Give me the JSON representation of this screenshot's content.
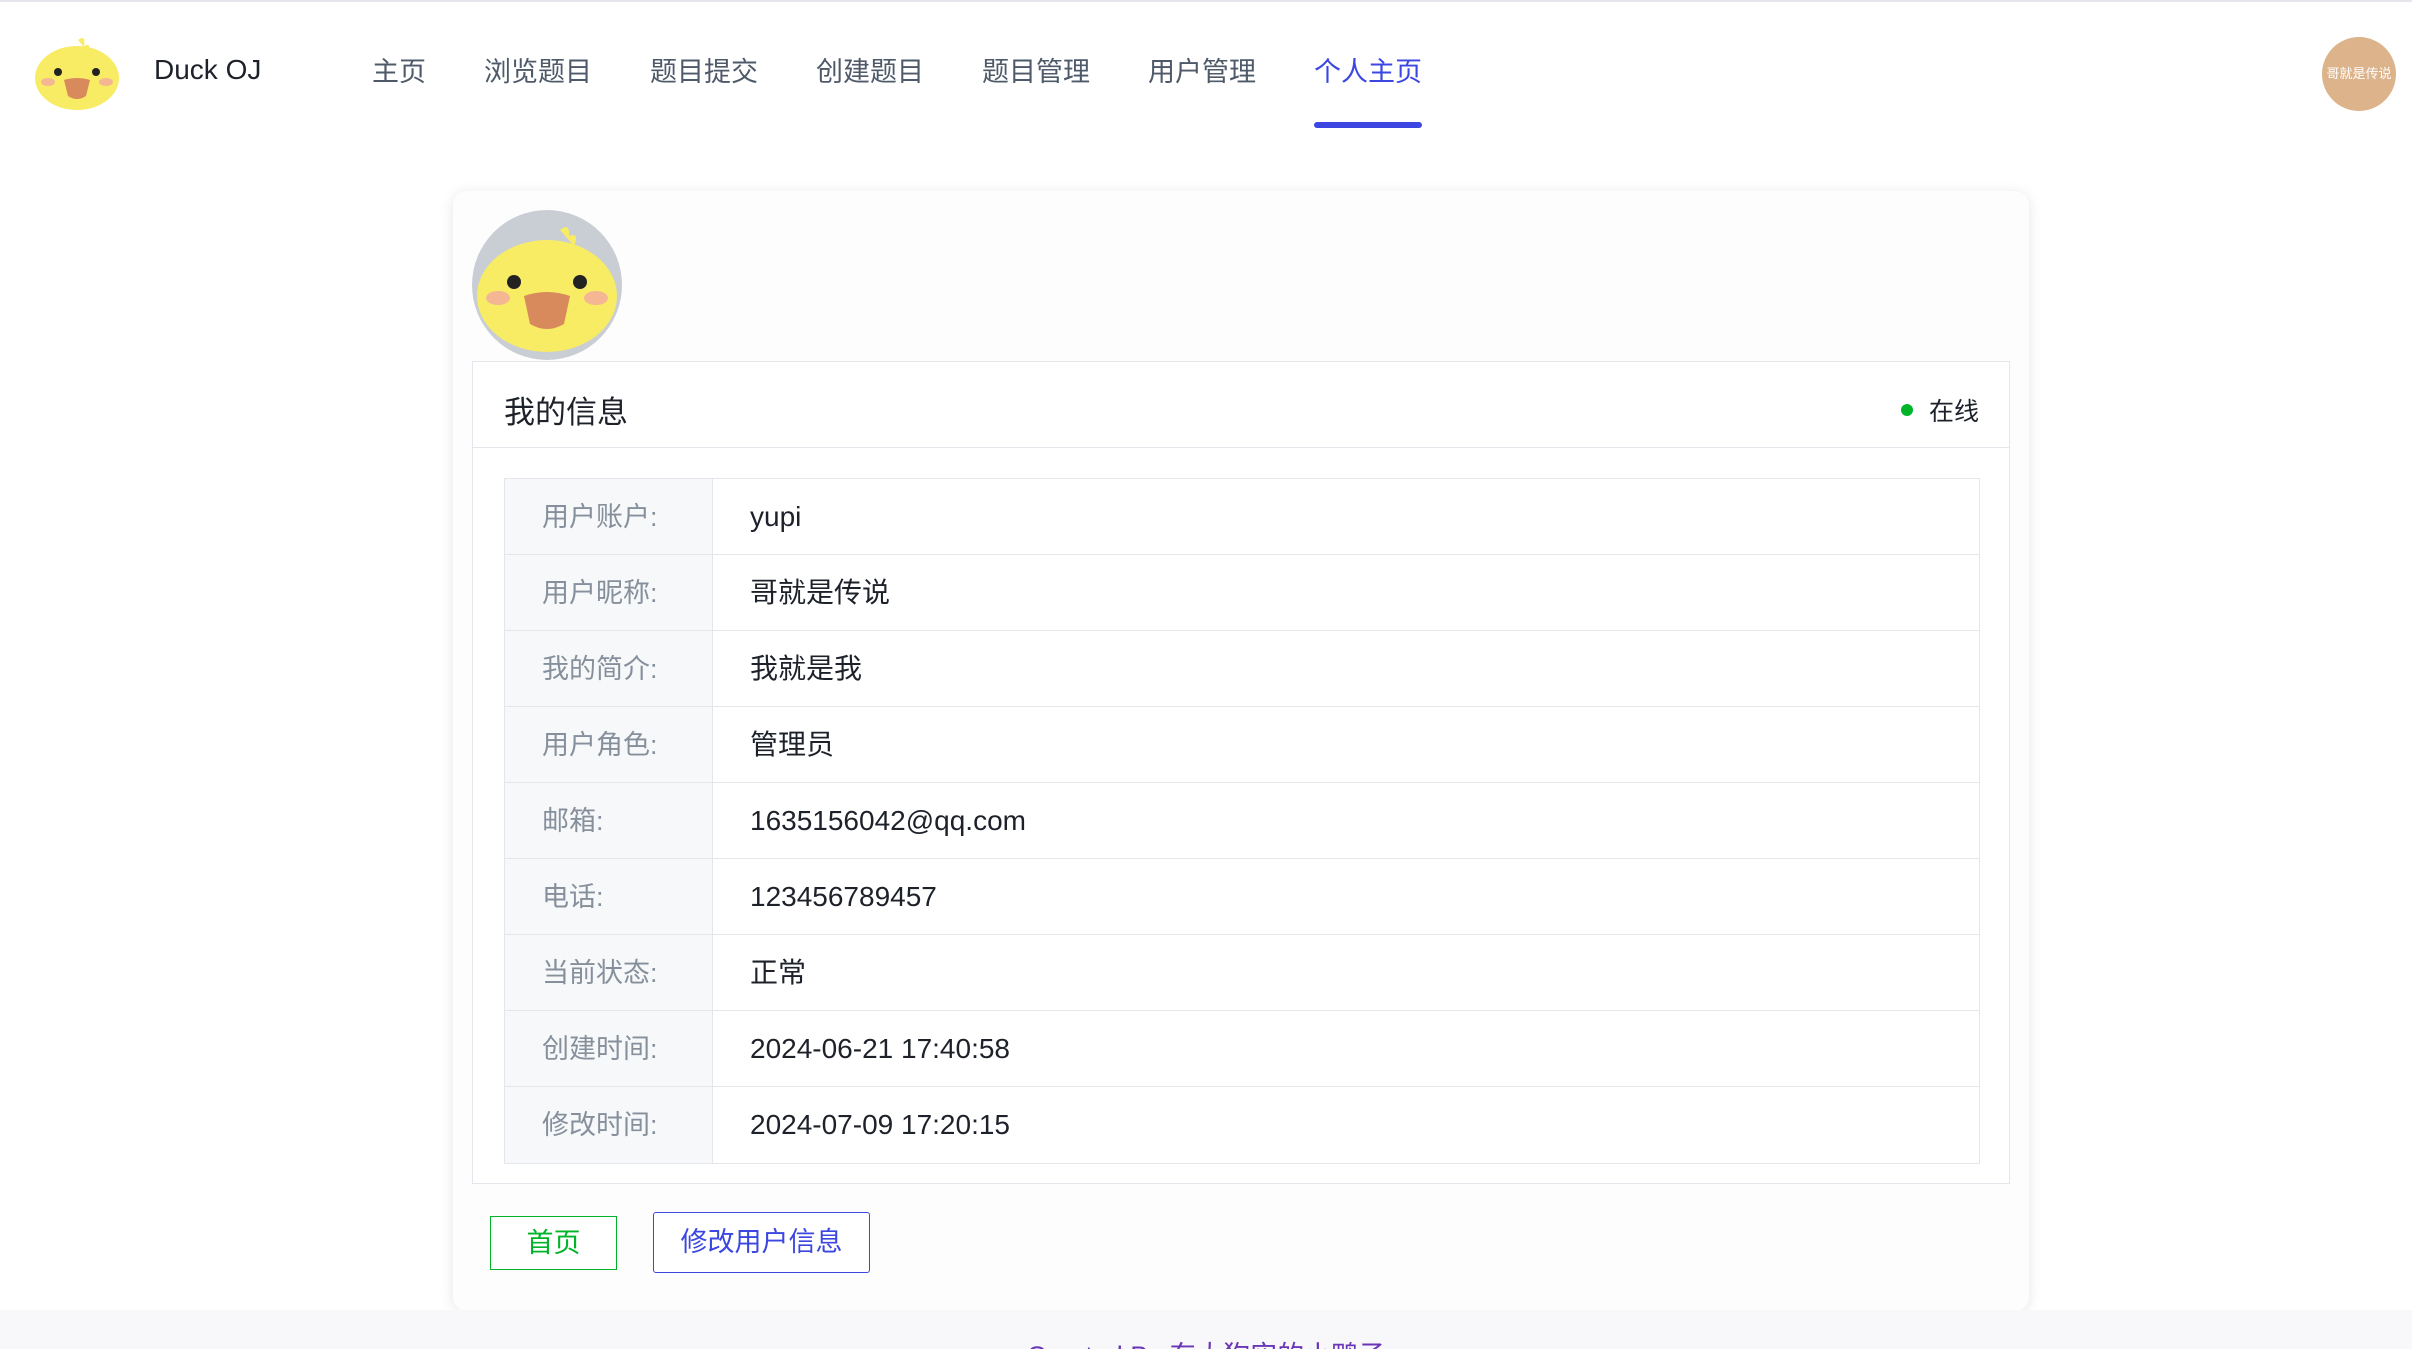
{
  "header": {
    "brand": "Duck OJ",
    "nav": [
      {
        "label": "主页",
        "active": false
      },
      {
        "label": "浏览题目",
        "active": false
      },
      {
        "label": "题目提交",
        "active": false
      },
      {
        "label": "创建题目",
        "active": false
      },
      {
        "label": "题目管理",
        "active": false
      },
      {
        "label": "用户管理",
        "active": false
      },
      {
        "label": "个人主页",
        "active": true
      }
    ],
    "user_avatar_text": "哥就是传说"
  },
  "profile": {
    "panel_title": "我的信息",
    "status_label": "在线",
    "fields": [
      {
        "label": "用户账户:",
        "value": "yupi"
      },
      {
        "label": "用户昵称:",
        "value": "哥就是传说"
      },
      {
        "label": "我的简介:",
        "value": "我就是我"
      },
      {
        "label": "用户角色:",
        "value": "管理员"
      },
      {
        "label": "邮箱:",
        "value": "1635156042@qq.com"
      },
      {
        "label": "电话:",
        "value": "123456789457"
      },
      {
        "label": "当前状态:",
        "value": "正常"
      },
      {
        "label": "创建时间:",
        "value": "2024-06-21 17:40:58"
      },
      {
        "label": "修改时间:",
        "value": "2024-07-09 17:20:15"
      }
    ],
    "buttons": {
      "home": "首页",
      "edit": "修改用户信息"
    }
  },
  "footer": {
    "text": "Created By 东大狗实的小鸭子"
  },
  "colors": {
    "accent": "#3b47e0",
    "online": "#00b42a",
    "avatar_bg": "#dcb38a"
  }
}
